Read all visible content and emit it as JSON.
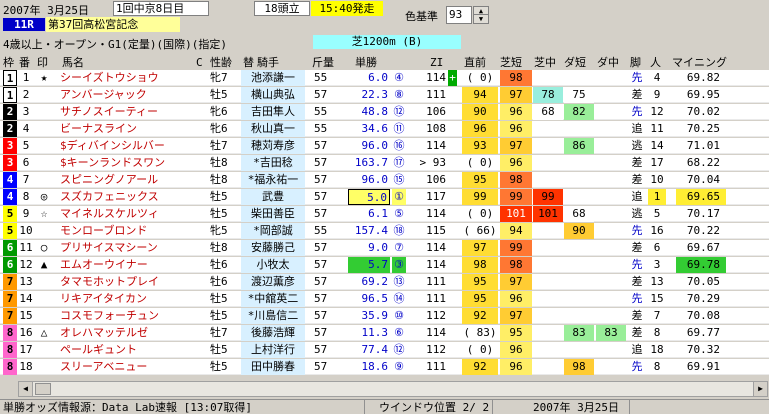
{
  "header": {
    "date": "2007年 3月25日",
    "meeting": "1回中京8日目",
    "runners": "18頭立",
    "post_time": "15:40発走",
    "color_basis_label": "色基準",
    "color_basis_value": "93",
    "race_number": "11R",
    "race_name": "第37回高松宮記念",
    "conditions": "4歳以上・オープン・G1(定量)(国際)(指定)",
    "course": "芝1200m (B)"
  },
  "columns": {
    "waku": "枠",
    "num": "番",
    "mark": "印",
    "name": "馬名",
    "c": "C",
    "sexage": "性齢",
    "hat": "替",
    "jockey": "騎手",
    "weight": "斤量",
    "win_odds": "単勝",
    "zi": "ZI",
    "prev": "直前",
    "turf_short": "芝短",
    "turf_mid": "芝中",
    "dirt_short": "ダ短",
    "dirt_mid": "ダ中",
    "style": "脚",
    "pop": "人",
    "mining": "マイニング"
  },
  "rows": [
    {
      "waku": "1",
      "num": "1",
      "mark": "★",
      "name": "シーイズトウショウ",
      "sexage": "牝7",
      "jockey": "池添謙一",
      "weight": "55",
      "odds": "6.0",
      "rank": "④",
      "zi": "114",
      "plus": "+",
      "prev": "( 0)",
      "ts": "98",
      "tm": "",
      "ds": "",
      "dm": "",
      "style": "先",
      "pop": "4",
      "mining": "69.82"
    },
    {
      "waku": "1",
      "num": "2",
      "mark": "",
      "name": "アンバージャック",
      "sexage": "牡5",
      "jockey": "横山典弘",
      "weight": "57",
      "odds": "22.3",
      "rank": "⑧",
      "zi": "111",
      "plus": "",
      "prev": "94",
      "ts": "97",
      "tm": "78",
      "ds": "75",
      "dm": "",
      "style": "差",
      "pop": "9",
      "mining": "69.95"
    },
    {
      "waku": "2",
      "num": "3",
      "mark": "",
      "name": "サチノスイーティー",
      "sexage": "牝6",
      "jockey": "吉田隼人",
      "weight": "55",
      "odds": "48.8",
      "rank": "⑫",
      "zi": "106",
      "plus": "",
      "prev": "90",
      "ts": "96",
      "tm": "68",
      "ds": "82",
      "dm": "",
      "style": "先",
      "pop": "12",
      "mining": "70.02"
    },
    {
      "waku": "2",
      "num": "4",
      "mark": "",
      "name": "ビーナスライン",
      "sexage": "牝6",
      "jockey": "秋山真一",
      "weight": "55",
      "odds": "34.6",
      "rank": "⑪",
      "zi": "108",
      "plus": "",
      "prev": "96",
      "ts": "96",
      "tm": "",
      "ds": "",
      "dm": "",
      "style": "追",
      "pop": "11",
      "mining": "70.25"
    },
    {
      "waku": "3",
      "num": "5",
      "mark": "",
      "name": "$ディバインシルバー",
      "sexage": "牡7",
      "jockey": "穂苅寿彦",
      "weight": "57",
      "odds": "96.0",
      "rank": "⑯",
      "zi": "114",
      "plus": "",
      "prev": "93",
      "ts": "97",
      "tm": "",
      "ds": "86",
      "dm": "",
      "style": "逃",
      "pop": "14",
      "mining": "71.01"
    },
    {
      "waku": "3",
      "num": "6",
      "mark": "",
      "name": "$キーンランドスワン",
      "sexage": "牡8",
      "jockey": "*吉田稔",
      "weight": "57",
      "odds": "163.7",
      "rank": "⑰",
      "zi": "> 93",
      "plus": "",
      "prev": "( 0)",
      "ts": "96",
      "tm": "",
      "ds": "",
      "dm": "",
      "style": "差",
      "pop": "17",
      "mining": "68.22"
    },
    {
      "waku": "4",
      "num": "7",
      "mark": "",
      "name": "スピニングノアール",
      "sexage": "牡8",
      "jockey": "*福永祐一",
      "weight": "57",
      "odds": "96.0",
      "rank": "⑮",
      "zi": "106",
      "plus": "",
      "prev": "95",
      "ts": "98",
      "tm": "",
      "ds": "",
      "dm": "",
      "style": "差",
      "pop": "10",
      "mining": "70.04"
    },
    {
      "waku": "4",
      "num": "8",
      "mark": "◎",
      "name": "スズカフェニックス",
      "sexage": "牡5",
      "jockey": "武豊",
      "weight": "57",
      "odds": "5.0",
      "rank": "①",
      "zi": "117",
      "plus": "",
      "prev": "99",
      "ts": "99",
      "tm": "99",
      "ds": "",
      "dm": "",
      "style": "追",
      "pop": "1",
      "mining": "69.65"
    },
    {
      "waku": "5",
      "num": "9",
      "mark": "☆",
      "name": "マイネルスケルツィ",
      "sexage": "牡5",
      "jockey": "柴田善臣",
      "weight": "57",
      "odds": "6.1",
      "rank": "⑤",
      "zi": "114",
      "plus": "",
      "prev": "( 0)",
      "ts": "101",
      "tm": "101",
      "ds": "68",
      "dm": "",
      "style": "逃",
      "pop": "5",
      "mining": "70.17"
    },
    {
      "waku": "5",
      "num": "10",
      "mark": "",
      "name": "モンローブロンド",
      "sexage": "牝5",
      "jockey": "*岡部誠",
      "weight": "55",
      "odds": "157.4",
      "rank": "⑱",
      "zi": "115",
      "plus": "",
      "prev": "( 66)",
      "ts": "94",
      "tm": "",
      "ds": "90",
      "dm": "",
      "style": "先",
      "pop": "16",
      "mining": "70.22"
    },
    {
      "waku": "6",
      "num": "11",
      "mark": "○",
      "name": "プリサイスマシーン",
      "sexage": "牡8",
      "jockey": "安藤勝己",
      "weight": "57",
      "odds": "9.0",
      "rank": "⑦",
      "zi": "114",
      "plus": "",
      "prev": "97",
      "ts": "99",
      "tm": "",
      "ds": "",
      "dm": "",
      "style": "差",
      "pop": "6",
      "mining": "69.67"
    },
    {
      "waku": "6",
      "num": "12",
      "mark": "▲",
      "name": "エムオーウイナー",
      "sexage": "牡6",
      "jockey": "小牧太",
      "weight": "57",
      "odds": "5.7",
      "rank": "③",
      "zi": "114",
      "plus": "",
      "prev": "98",
      "ts": "98",
      "tm": "",
      "ds": "",
      "dm": "",
      "style": "先",
      "pop": "3",
      "mining": "69.78"
    },
    {
      "waku": "7",
      "num": "13",
      "mark": "",
      "name": "タマモホットプレイ",
      "sexage": "牡6",
      "jockey": "渡辺薫彦",
      "weight": "57",
      "odds": "69.2",
      "rank": "⑬",
      "zi": "111",
      "plus": "",
      "prev": "95",
      "ts": "97",
      "tm": "",
      "ds": "",
      "dm": "",
      "style": "差",
      "pop": "13",
      "mining": "70.05"
    },
    {
      "waku": "7",
      "num": "14",
      "mark": "",
      "name": "リキアイタイカン",
      "sexage": "牡5",
      "jockey": "*中舘英二",
      "weight": "57",
      "odds": "96.5",
      "rank": "⑭",
      "zi": "111",
      "plus": "",
      "prev": "95",
      "ts": "96",
      "tm": "",
      "ds": "",
      "dm": "",
      "style": "先",
      "pop": "15",
      "mining": "70.29"
    },
    {
      "waku": "7",
      "num": "15",
      "mark": "",
      "name": "コスモフォーチュン",
      "sexage": "牡5",
      "jockey": "*川島信二",
      "weight": "57",
      "odds": "35.9",
      "rank": "⑩",
      "zi": "112",
      "plus": "",
      "prev": "92",
      "ts": "97",
      "tm": "",
      "ds": "",
      "dm": "",
      "style": "差",
      "pop": "7",
      "mining": "70.08"
    },
    {
      "waku": "8",
      "num": "16",
      "mark": "△",
      "name": "オレハマッテルゼ",
      "sexage": "牡7",
      "jockey": "後藤浩輝",
      "weight": "57",
      "odds": "11.3",
      "rank": "⑥",
      "zi": "114",
      "plus": "",
      "prev": "( 83)",
      "ts": "95",
      "tm": "",
      "ds": "83",
      "dm": "83",
      "style": "差",
      "pop": "8",
      "mining": "69.77"
    },
    {
      "waku": "8",
      "num": "17",
      "mark": "",
      "name": "ペールギュント",
      "sexage": "牡5",
      "jockey": "上村洋行",
      "weight": "57",
      "odds": "77.4",
      "rank": "⑫",
      "zi": "112",
      "plus": "",
      "prev": "( 0)",
      "ts": "96",
      "tm": "",
      "ds": "",
      "dm": "",
      "style": "追",
      "pop": "18",
      "mining": "70.32"
    },
    {
      "waku": "8",
      "num": "18",
      "mark": "",
      "name": "スリーアベニュー",
      "sexage": "牡5",
      "jockey": "田中勝春",
      "weight": "57",
      "odds": "18.6",
      "rank": "⑨",
      "zi": "111",
      "plus": "",
      "prev": "92",
      "ts": "96",
      "tm": "",
      "ds": "98",
      "dm": "",
      "style": "先",
      "pop": "8",
      "mining": "69.91"
    }
  ],
  "status": {
    "source": "単勝オッズ情報源：Data Lab速報 [13:07取得]",
    "window": "ウインドウ位置 2/ 2",
    "date": "2007年 3月25日"
  },
  "colors": {
    "waku": [
      "#ffffff",
      "#000000",
      "#ff0000",
      "#0000ff",
      "#ffff00",
      "#009900",
      "#ff9900",
      "#ff66cc"
    ]
  }
}
